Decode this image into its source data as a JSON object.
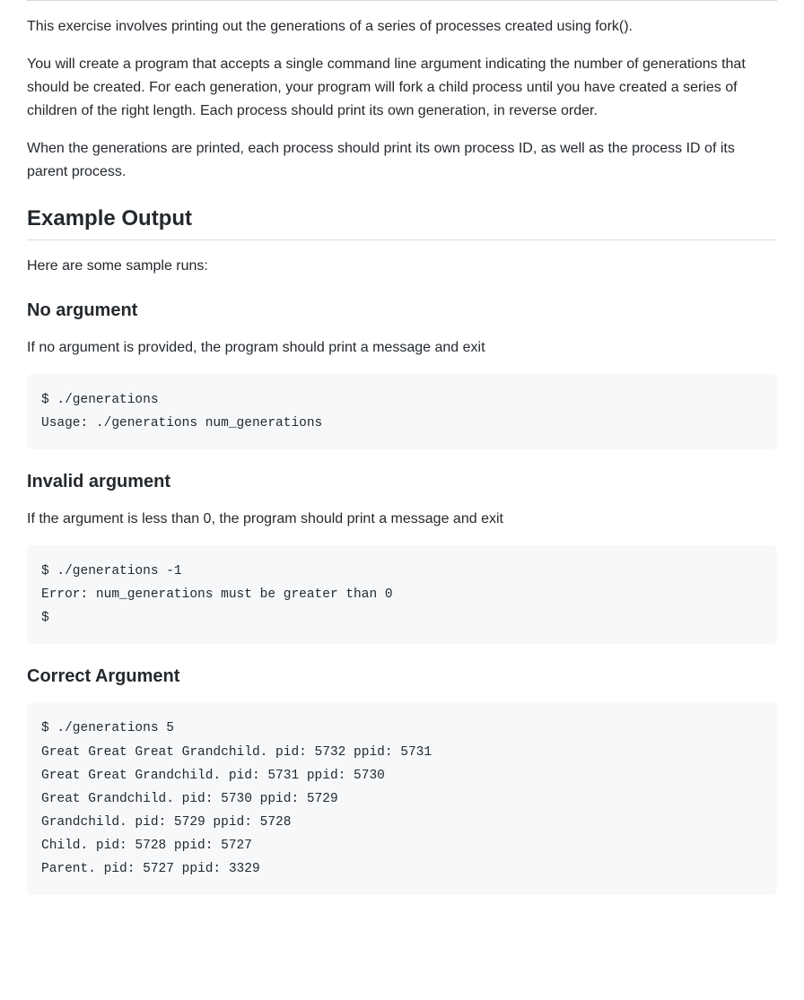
{
  "intro": {
    "p1": "This exercise involves printing out the generations of a series of processes created using fork().",
    "p2": "You will create a program that accepts a single command line argument indicating the number of generations that should be created. For each generation, your program will fork a child process until you have created a series of children of the right length. Each process should print its own generation, in reverse order.",
    "p3": "When the generations are printed, each process should print its own process ID, as well as the process ID of its parent process."
  },
  "example": {
    "heading": "Example Output",
    "lead": "Here are some sample runs:",
    "noarg": {
      "heading": "No argument",
      "desc": "If no argument is provided, the program should print a message and exit",
      "code": "$ ./generations\nUsage: ./generations num_generations"
    },
    "invalid": {
      "heading": "Invalid argument",
      "desc": "If the argument is less than 0, the program should print a message and exit",
      "code": "$ ./generations -1\nError: num_generations must be greater than 0\n$"
    },
    "correct": {
      "heading": "Correct Argument",
      "code": "$ ./generations 5\nGreat Great Great Grandchild. pid: 5732 ppid: 5731\nGreat Great Grandchild. pid: 5731 ppid: 5730\nGreat Grandchild. pid: 5730 ppid: 5729\nGrandchild. pid: 5729 ppid: 5728\nChild. pid: 5728 ppid: 5727\nParent. pid: 5727 ppid: 3329"
    }
  }
}
